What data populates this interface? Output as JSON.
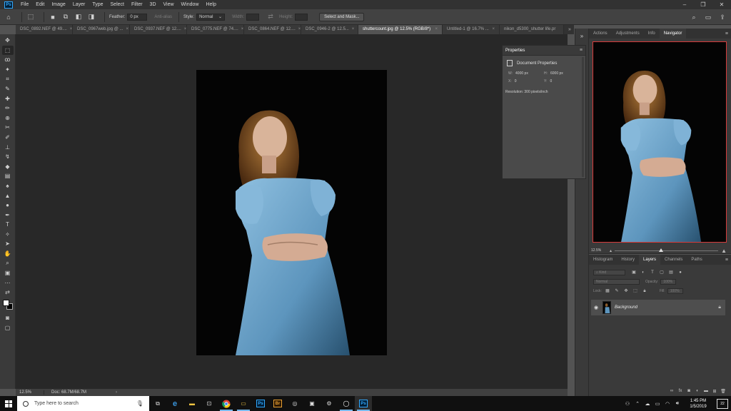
{
  "app": {
    "logo": "Ps",
    "menu": [
      "File",
      "Edit",
      "Image",
      "Layer",
      "Type",
      "Select",
      "Filter",
      "3D",
      "View",
      "Window",
      "Help"
    ],
    "window_controls": [
      "–",
      "❐",
      "✕"
    ]
  },
  "options": {
    "feather_label": "Feather:",
    "feather_value": "0 px",
    "antialias_label": "Anti-alias",
    "style_label": "Style:",
    "style_value": "Normal",
    "width_label": "Width:",
    "height_label": "Height:",
    "select_mask_button": "Select and Mask..."
  },
  "tabs": [
    {
      "label": "DSC_0892.NEF @ 49....",
      "active": false
    },
    {
      "label": "DSC_0967web.jpg @ ...",
      "active": false
    },
    {
      "label": "DSC_0937.NEF @ 12....",
      "active": false
    },
    {
      "label": "DSC_0775.NEF @ 74....",
      "active": false
    },
    {
      "label": "DSC_0864.NEF @ 12....",
      "active": false
    },
    {
      "label": "DSC_0946-2 @ 12.5...",
      "active": false
    },
    {
      "label": "shuttercount.jpg @ 12.5% (RGB/8*)",
      "active": true
    },
    {
      "label": "Untitled-1 @ 16.7% ...",
      "active": false
    },
    {
      "label": "nikon_d5300_shutter life.pr",
      "active": false
    }
  ],
  "tab_overflow": "»",
  "status": {
    "zoom": "12.5%",
    "doc": "Doc: 68.7M/68.7M",
    "arrow": "›"
  },
  "properties": {
    "title": "Properties",
    "doc_label": "Document Properties",
    "w_key": "W:",
    "w_value": "4000 px",
    "h_key": "H:",
    "h_value": "6000 px",
    "x_key": "X:",
    "x_value": "0",
    "y_key": "Y:",
    "y_value": "0",
    "resolution": "Resolution: 300 pixels/inch"
  },
  "navigator": {
    "tabs": [
      "Actions",
      "Adjustments",
      "Info",
      "Navigator"
    ],
    "active_tab": "Navigator",
    "zoom": "12.5%",
    "zoom_fraction": 0.45
  },
  "layers": {
    "tabs": [
      "Histogram",
      "History",
      "Layers",
      "Channels",
      "Paths"
    ],
    "active_tab": "Layers",
    "kind_placeholder": "Kind",
    "blend_mode": "Normal",
    "opacity_label": "Opacity:",
    "opacity_value": "100%",
    "lock_label": "Lock:",
    "fill_label": "Fill:",
    "fill_value": "100%",
    "layer_name": "Background"
  },
  "taskbar": {
    "search_placeholder": "Type here to search",
    "time": "1:45 PM",
    "date": "1/5/2019",
    "notifications": "22"
  },
  "colors": {
    "accent": "#31a8ff",
    "nav_border": "#d63b3b",
    "dress": "#6fa3c9"
  }
}
